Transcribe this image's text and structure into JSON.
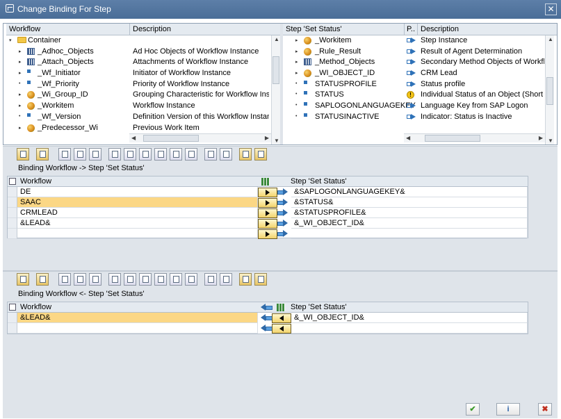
{
  "window": {
    "title": "Change Binding For Step",
    "close": "✕"
  },
  "left_tree": {
    "col_workflow": "Workflow",
    "col_description": "Description",
    "rows": [
      {
        "name": "Container",
        "desc": "",
        "icon": "folder-icon",
        "arrow": "▾"
      },
      {
        "name": "_Adhoc_Objects",
        "desc": "Ad Hoc Objects of Workflow Instance",
        "icon": "table-icon",
        "arrow": "▸"
      },
      {
        "name": "_Attach_Objects",
        "desc": "Attachments of Workflow Instance",
        "icon": "table-icon",
        "arrow": "▸"
      },
      {
        "name": "_Wf_Initiator",
        "desc": "Initiator of Workflow Instance",
        "icon": "field-icon",
        "arrow": "▸"
      },
      {
        "name": "_Wf_Priority",
        "desc": "Priority of Workflow Instance",
        "icon": "field-icon",
        "arrow": "•"
      },
      {
        "name": "_Wi_Group_ID",
        "desc": "Grouping Characteristic for Workflow Instar",
        "icon": "object-icon",
        "arrow": "▸"
      },
      {
        "name": "_Workitem",
        "desc": "Workflow Instance",
        "icon": "object-icon",
        "arrow": "▸"
      },
      {
        "name": "_Wf_Version",
        "desc": "Definition Version of this Workflow Instance",
        "icon": "field-icon",
        "arrow": "•"
      },
      {
        "name": "_Predecessor_Wi",
        "desc": "Previous Work Item",
        "icon": "object-icon",
        "arrow": "▸"
      }
    ]
  },
  "right_tree": {
    "col_step": "Step 'Set Status'",
    "col_p": "P..",
    "col_description": "Description",
    "rows": [
      {
        "name": "_Workitem",
        "desc": "Step Instance",
        "icon": "object-icon",
        "arrow": "▸"
      },
      {
        "name": "_Rule_Result",
        "desc": "Result of Agent Determination",
        "icon": "object-icon",
        "arrow": "▸"
      },
      {
        "name": "_Method_Objects",
        "desc": "Secondary Method Objects of Workflow",
        "icon": "table-icon",
        "arrow": "▸"
      },
      {
        "name": "_WI_OBJECT_ID",
        "desc": "CRM Lead",
        "icon": "object-icon",
        "arrow": "▸"
      },
      {
        "name": "STATUSPROFILE",
        "desc": "Status profile",
        "icon": "field-icon",
        "arrow": "•"
      },
      {
        "name": "STATUS",
        "desc": "Individual Status of an Object (Short F",
        "icon": "field-icon",
        "arrow": "•",
        "pwarn": "!"
      },
      {
        "name": "SAPLOGONLANGUAGEKEY",
        "desc": "Language Key from SAP Logon",
        "icon": "field-icon",
        "arrow": "•"
      },
      {
        "name": "STATUSINACTIVE",
        "desc": "Indicator: Status is Inactive",
        "icon": "field-icon",
        "arrow": "•"
      }
    ]
  },
  "binding_to": {
    "label": "Binding Workflow  -> Step 'Set Status'",
    "col_left": "Workflow",
    "col_right": "Step 'Set Status'",
    "rows": [
      {
        "left": "DE",
        "right": "&SAPLOGONLANGUAGEKEY&",
        "selected": false
      },
      {
        "left": "SAAC",
        "right": "&STATUS&",
        "selected": true
      },
      {
        "left": "CRMLEAD",
        "right": "&STATUSPROFILE&",
        "selected": false
      },
      {
        "left": "&LEAD&",
        "right": "&_WI_OBJECT_ID&",
        "selected": false
      },
      {
        "left": "",
        "right": "",
        "selected": false
      }
    ]
  },
  "binding_from": {
    "label": "Binding Workflow  <- Step 'Set Status'",
    "col_left": "Workflow",
    "col_right": "Step 'Set Status'",
    "rows": [
      {
        "left": "&LEAD&",
        "right": "&_WI_OBJECT_ID&",
        "selected": true
      },
      {
        "left": "",
        "right": "",
        "selected": false
      }
    ]
  },
  "footer": {
    "ok": "✔",
    "info": "i",
    "cancel": "✖"
  },
  "colors": {
    "title_bar": "#5d7fa8",
    "selection": "#fbd785",
    "panel_bg": "#dfe4ea"
  }
}
